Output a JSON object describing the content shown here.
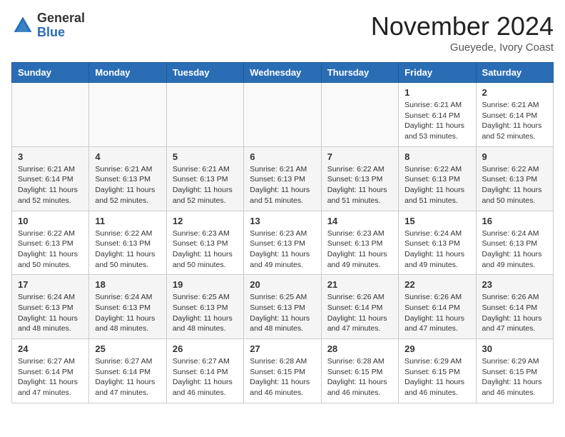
{
  "header": {
    "logo_general": "General",
    "logo_blue": "Blue",
    "month_title": "November 2024",
    "location": "Gueyede, Ivory Coast"
  },
  "days_of_week": [
    "Sunday",
    "Monday",
    "Tuesday",
    "Wednesday",
    "Thursday",
    "Friday",
    "Saturday"
  ],
  "weeks": [
    [
      {
        "day": "",
        "empty": true
      },
      {
        "day": "",
        "empty": true
      },
      {
        "day": "",
        "empty": true
      },
      {
        "day": "",
        "empty": true
      },
      {
        "day": "",
        "empty": true
      },
      {
        "day": "1",
        "sunrise": "Sunrise: 6:21 AM",
        "sunset": "Sunset: 6:14 PM",
        "daylight": "Daylight: 11 hours and 53 minutes."
      },
      {
        "day": "2",
        "sunrise": "Sunrise: 6:21 AM",
        "sunset": "Sunset: 6:14 PM",
        "daylight": "Daylight: 11 hours and 52 minutes."
      }
    ],
    [
      {
        "day": "3",
        "sunrise": "Sunrise: 6:21 AM",
        "sunset": "Sunset: 6:14 PM",
        "daylight": "Daylight: 11 hours and 52 minutes."
      },
      {
        "day": "4",
        "sunrise": "Sunrise: 6:21 AM",
        "sunset": "Sunset: 6:13 PM",
        "daylight": "Daylight: 11 hours and 52 minutes."
      },
      {
        "day": "5",
        "sunrise": "Sunrise: 6:21 AM",
        "sunset": "Sunset: 6:13 PM",
        "daylight": "Daylight: 11 hours and 52 minutes."
      },
      {
        "day": "6",
        "sunrise": "Sunrise: 6:21 AM",
        "sunset": "Sunset: 6:13 PM",
        "daylight": "Daylight: 11 hours and 51 minutes."
      },
      {
        "day": "7",
        "sunrise": "Sunrise: 6:22 AM",
        "sunset": "Sunset: 6:13 PM",
        "daylight": "Daylight: 11 hours and 51 minutes."
      },
      {
        "day": "8",
        "sunrise": "Sunrise: 6:22 AM",
        "sunset": "Sunset: 6:13 PM",
        "daylight": "Daylight: 11 hours and 51 minutes."
      },
      {
        "day": "9",
        "sunrise": "Sunrise: 6:22 AM",
        "sunset": "Sunset: 6:13 PM",
        "daylight": "Daylight: 11 hours and 50 minutes."
      }
    ],
    [
      {
        "day": "10",
        "sunrise": "Sunrise: 6:22 AM",
        "sunset": "Sunset: 6:13 PM",
        "daylight": "Daylight: 11 hours and 50 minutes."
      },
      {
        "day": "11",
        "sunrise": "Sunrise: 6:22 AM",
        "sunset": "Sunset: 6:13 PM",
        "daylight": "Daylight: 11 hours and 50 minutes."
      },
      {
        "day": "12",
        "sunrise": "Sunrise: 6:23 AM",
        "sunset": "Sunset: 6:13 PM",
        "daylight": "Daylight: 11 hours and 50 minutes."
      },
      {
        "day": "13",
        "sunrise": "Sunrise: 6:23 AM",
        "sunset": "Sunset: 6:13 PM",
        "daylight": "Daylight: 11 hours and 49 minutes."
      },
      {
        "day": "14",
        "sunrise": "Sunrise: 6:23 AM",
        "sunset": "Sunset: 6:13 PM",
        "daylight": "Daylight: 11 hours and 49 minutes."
      },
      {
        "day": "15",
        "sunrise": "Sunrise: 6:24 AM",
        "sunset": "Sunset: 6:13 PM",
        "daylight": "Daylight: 11 hours and 49 minutes."
      },
      {
        "day": "16",
        "sunrise": "Sunrise: 6:24 AM",
        "sunset": "Sunset: 6:13 PM",
        "daylight": "Daylight: 11 hours and 49 minutes."
      }
    ],
    [
      {
        "day": "17",
        "sunrise": "Sunrise: 6:24 AM",
        "sunset": "Sunset: 6:13 PM",
        "daylight": "Daylight: 11 hours and 48 minutes."
      },
      {
        "day": "18",
        "sunrise": "Sunrise: 6:24 AM",
        "sunset": "Sunset: 6:13 PM",
        "daylight": "Daylight: 11 hours and 48 minutes."
      },
      {
        "day": "19",
        "sunrise": "Sunrise: 6:25 AM",
        "sunset": "Sunset: 6:13 PM",
        "daylight": "Daylight: 11 hours and 48 minutes."
      },
      {
        "day": "20",
        "sunrise": "Sunrise: 6:25 AM",
        "sunset": "Sunset: 6:13 PM",
        "daylight": "Daylight: 11 hours and 48 minutes."
      },
      {
        "day": "21",
        "sunrise": "Sunrise: 6:26 AM",
        "sunset": "Sunset: 6:14 PM",
        "daylight": "Daylight: 11 hours and 47 minutes."
      },
      {
        "day": "22",
        "sunrise": "Sunrise: 6:26 AM",
        "sunset": "Sunset: 6:14 PM",
        "daylight": "Daylight: 11 hours and 47 minutes."
      },
      {
        "day": "23",
        "sunrise": "Sunrise: 6:26 AM",
        "sunset": "Sunset: 6:14 PM",
        "daylight": "Daylight: 11 hours and 47 minutes."
      }
    ],
    [
      {
        "day": "24",
        "sunrise": "Sunrise: 6:27 AM",
        "sunset": "Sunset: 6:14 PM",
        "daylight": "Daylight: 11 hours and 47 minutes."
      },
      {
        "day": "25",
        "sunrise": "Sunrise: 6:27 AM",
        "sunset": "Sunset: 6:14 PM",
        "daylight": "Daylight: 11 hours and 47 minutes."
      },
      {
        "day": "26",
        "sunrise": "Sunrise: 6:27 AM",
        "sunset": "Sunset: 6:14 PM",
        "daylight": "Daylight: 11 hours and 46 minutes."
      },
      {
        "day": "27",
        "sunrise": "Sunrise: 6:28 AM",
        "sunset": "Sunset: 6:15 PM",
        "daylight": "Daylight: 11 hours and 46 minutes."
      },
      {
        "day": "28",
        "sunrise": "Sunrise: 6:28 AM",
        "sunset": "Sunset: 6:15 PM",
        "daylight": "Daylight: 11 hours and 46 minutes."
      },
      {
        "day": "29",
        "sunrise": "Sunrise: 6:29 AM",
        "sunset": "Sunset: 6:15 PM",
        "daylight": "Daylight: 11 hours and 46 minutes."
      },
      {
        "day": "30",
        "sunrise": "Sunrise: 6:29 AM",
        "sunset": "Sunset: 6:15 PM",
        "daylight": "Daylight: 11 hours and 46 minutes."
      }
    ]
  ]
}
